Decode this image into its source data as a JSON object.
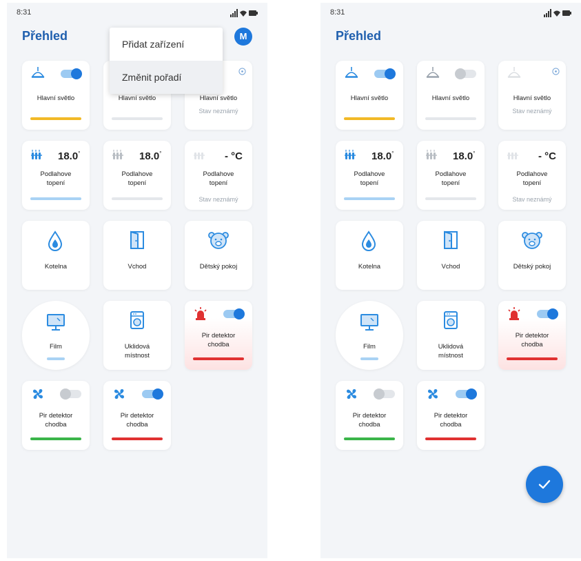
{
  "status": {
    "time": "8:31"
  },
  "header": {
    "title": "Přehled",
    "avatar_initial": "M"
  },
  "menu": {
    "items": [
      "Přidat zařízení",
      "Změnit pořadí"
    ]
  },
  "tiles": {
    "light_1": {
      "label": "Hlavní světlo",
      "toggle": "on",
      "bar_color": "#f2b927"
    },
    "light_2": {
      "label": "Hlavní světlo",
      "toggle": "off",
      "bar_color": "#e4e7eb"
    },
    "light_3": {
      "label": "Hlavní světlo",
      "status": "Stav neznámý"
    },
    "floor_1": {
      "temp": "18.0",
      "unit": "°",
      "label": "Podlahove topení",
      "bar_color": "#a9d2f4"
    },
    "floor_2": {
      "temp": "18.0",
      "unit": "°",
      "label": "Podlahove topení",
      "bar_color": "#e4e7eb"
    },
    "floor_3": {
      "temp": "- °C",
      "label": "Podlahove topení",
      "status": "Stav neznámý"
    },
    "boiler": {
      "label": "Kotelna"
    },
    "entrance": {
      "label": "Vchod"
    },
    "kids_room": {
      "label": "Dětský pokoj"
    },
    "film": {
      "label": "Film",
      "bar_color": "#a9d2f4"
    },
    "laundry": {
      "label": "Uklidová místnost"
    },
    "pir_alarm": {
      "label": "Pir detektor chodba",
      "toggle": "on",
      "bar_color": "#e03131"
    },
    "pir_1": {
      "label": "Pir detektor chodba",
      "toggle": "off",
      "bar_color": "#3bb54a"
    },
    "pir_2": {
      "label": "Pir detektor chodba",
      "toggle": "on",
      "bar_color": "#e03131"
    }
  },
  "colors": {
    "accent": "#1e78dc",
    "title": "#1f5fae",
    "alarm": "#e03131",
    "icon_blue": "#2b8be0"
  },
  "icons": [
    "ceiling-lamp-icon",
    "radiator-icon",
    "water-drop-icon",
    "door-icon",
    "bear-face-icon",
    "monitor-icon",
    "washing-machine-icon",
    "alarm-siren-icon",
    "fan-icon",
    "info-icon",
    "checkmark-icon",
    "signal-icon",
    "wifi-icon",
    "battery-icon"
  ]
}
